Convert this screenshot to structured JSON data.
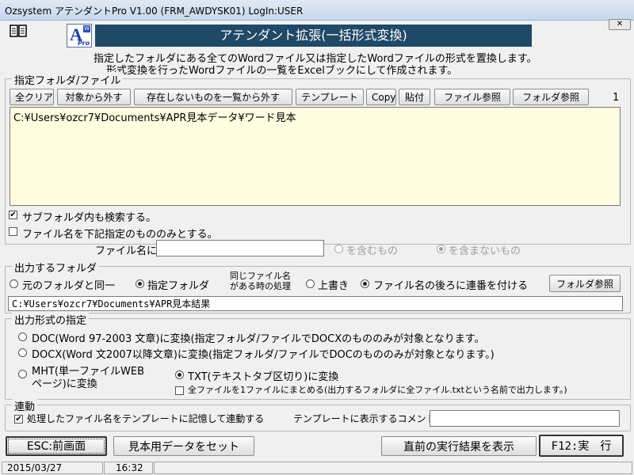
{
  "window": {
    "title": "Ozsystem アテンダントPro V1.00 (FRM_AWDYSK01) LogIn:USER"
  },
  "header": {
    "banner": "アテンダント拡張(一括形式変換)",
    "desc_line1": "指定したフォルダにある全てのWordファイル又は指定したWordファイルの形式を置換します。",
    "desc_line2": "形式変換を行ったWordファイルの一覧をExcelブックにして作成されます。",
    "logo_letter": "A",
    "logo_sub": "Pro",
    "logo_badge": "W"
  },
  "source_group": {
    "title": "指定フォルダ/ファイル",
    "buttons": {
      "clear_all": "全クリア",
      "remove": "対象から外す",
      "remove_missing": "存在しないものを一覧から外す",
      "template": "テンプレート",
      "copy": "Copy",
      "paste": "貼付",
      "file_browse": "ファイル参照",
      "folder_browse": "フォルダ参照"
    },
    "count": "1",
    "path_list": "C:¥Users¥ozcr7¥Documents¥APR見本データ¥ワード見本",
    "include_subfolders": "サブフォルダ内も検索する。",
    "include_subfolders_checked": true,
    "filter_filename": "ファイル名を下記指定のもののみとする。",
    "filter_filename_checked": false,
    "filename_label": "ファイル名に",
    "filename_value": "",
    "contains": "を含むもの",
    "not_contains": "を含まないもの"
  },
  "output_group": {
    "title": "出力するフォルダ",
    "same_folder": "元のフォルダと同一",
    "specified_folder": "指定フォルダ",
    "conflict_label_line1": "同じファイル名",
    "conflict_label_line2": "がある時の処理",
    "overwrite": "上書き",
    "append_number": "ファイル名の後ろに連番を付ける",
    "folder_browse": "フォルダ参照",
    "path": "C:¥Users¥ozcr7¥Documents¥APR見本結果"
  },
  "format_group": {
    "title": "出力形式の指定",
    "doc": "DOC(Word 97-2003 文章)に変換(指定フォルダ/ファイルでDOCXのもののみが対象となります。",
    "docx": "DOCX(Word 文2007以降文章)に変換(指定フォルダ/ファイルでDOCのもののみが対象となります。)",
    "mht_line1": "MHT(単一ファイルWEB",
    "mht_line2": "ページ)に変換",
    "txt": "TXT(テキストタブ区切り)に変換",
    "merge": "全ファイルを1ファイルにまとめる(出力するフォルダに全ファイル.txtという名前で出力します。)"
  },
  "link_group": {
    "title": "連動",
    "remember_template": "処理したファイル名をテンプレートに記憶して連動する",
    "remember_template_checked": true,
    "comment_label": "テンプレートに表示するコメント",
    "comment_value": ""
  },
  "footer": {
    "esc": "ESC:前画面",
    "sample": "見本用データをセット",
    "show_result": "直前の実行結果を表示",
    "run": "F12:実　行"
  },
  "status": {
    "date": "2015/03/27",
    "time": "16:32"
  },
  "colors": {
    "banner": "#1f4967",
    "path_bg": "#fffde0"
  }
}
